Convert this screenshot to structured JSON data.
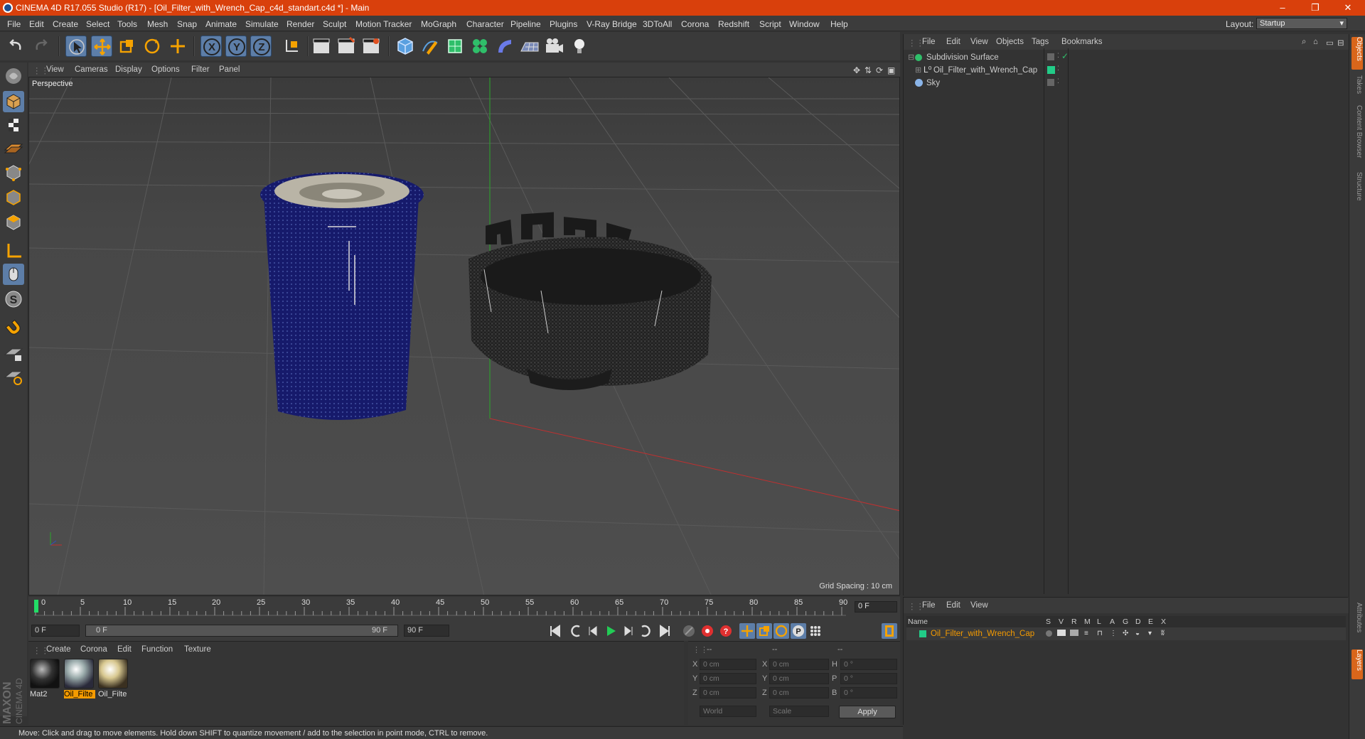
{
  "window": {
    "title": "CINEMA 4D R17.055 Studio (R17) - [Oil_Filter_with_Wrench_Cap_c4d_standart.c4d *] - Main",
    "minimize": "–",
    "restore": "❐",
    "close": "✕"
  },
  "menubar": {
    "items": [
      "File",
      "Edit",
      "Create",
      "Select",
      "Tools",
      "Mesh",
      "Snap",
      "Animate",
      "Simulate",
      "Render",
      "Sculpt",
      "Motion Tracker",
      "MoGraph",
      "Character",
      "Pipeline",
      "Plugins",
      "V-Ray Bridge",
      "3DToAll",
      "Corona",
      "Redshift",
      "Script",
      "Window",
      "Help"
    ],
    "layout_label": "Layout:",
    "layout_value": "Startup"
  },
  "viewport": {
    "menu": [
      "View",
      "Cameras",
      "Display",
      "Options",
      "Filter",
      "Panel"
    ],
    "label": "Perspective",
    "grid_spacing": "Grid Spacing : 10 cm"
  },
  "timeline": {
    "ticks": [
      "0",
      "5",
      "10",
      "15",
      "20",
      "25",
      "30",
      "35",
      "40",
      "45",
      "50",
      "55",
      "60",
      "65",
      "70",
      "75",
      "80",
      "85",
      "90"
    ],
    "current_frame": "0 F",
    "start_field": "0 F",
    "range_start": "0 F",
    "range_end": "90 F",
    "end_field": "90 F"
  },
  "materials": {
    "menu": [
      "Create",
      "Corona",
      "Edit",
      "Function",
      "Texture"
    ],
    "items": [
      {
        "label": "Mat2"
      },
      {
        "label": "Oil_Filte"
      },
      {
        "label": "Oil_Filte"
      }
    ]
  },
  "coords": {
    "headers": [
      "--",
      "--",
      "--"
    ],
    "rows": [
      {
        "a": "X",
        "av": "0 cm",
        "b": "X",
        "bv": "0 cm",
        "c": "H",
        "cv": "0 °"
      },
      {
        "a": "Y",
        "av": "0 cm",
        "b": "Y",
        "bv": "0 cm",
        "c": "P",
        "cv": "0 °"
      },
      {
        "a": "Z",
        "av": "0 cm",
        "b": "Z",
        "bv": "0 cm",
        "c": "B",
        "cv": "0 °"
      }
    ],
    "mode1": "World",
    "mode2": "Scale",
    "apply": "Apply"
  },
  "status": "Move: Click and drag to move elements. Hold down SHIFT to quantize movement / add to the selection in point mode, CTRL to remove.",
  "object_manager": {
    "menu": [
      "File",
      "Edit",
      "View",
      "Objects",
      "Tags",
      "Bookmarks"
    ],
    "objects": [
      {
        "name": "Subdivision Surface"
      },
      {
        "name": "Oil_Filter_with_Wrench_Cap"
      },
      {
        "name": "Sky"
      }
    ]
  },
  "layer_manager": {
    "menu": [
      "File",
      "Edit",
      "View"
    ],
    "columns": [
      "Name",
      "S",
      "V",
      "R",
      "M",
      "L",
      "A",
      "G",
      "D",
      "E",
      "X"
    ],
    "layer_name": "Oil_Filter_with_Wrench_Cap"
  },
  "right_tabs": [
    "Objects",
    "Takes",
    "Content Browser",
    "Structure",
    "Attributes",
    "Layers"
  ],
  "brand": {
    "line1": "MAXON",
    "line2": "CINEMA 4D"
  },
  "colors": {
    "accent": "#d9400c",
    "selection": "#5d7ea8",
    "layer_green": "#22cc88",
    "highlight": "#f59b00"
  }
}
